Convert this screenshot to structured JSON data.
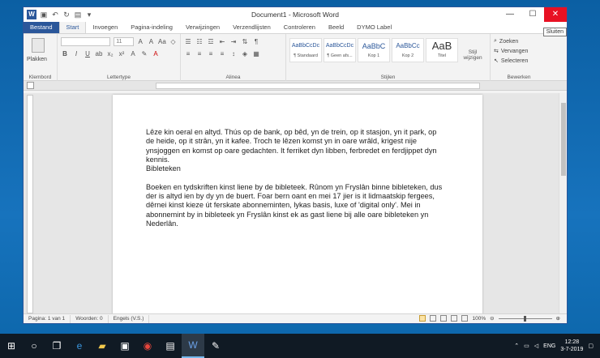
{
  "titlebar": {
    "title": "Document1 - Microsoft Word",
    "tooltip": "Sluiten",
    "controls": [
      "—",
      "☐",
      "✕"
    ]
  },
  "tabs": [
    "Bestand",
    "Start",
    "Invoegen",
    "Pagina-indeling",
    "Verwijzingen",
    "Verzendlijsten",
    "Controleren",
    "Beeld",
    "DYMO Label"
  ],
  "ribbon": {
    "clipboard": {
      "paste": "Plakken",
      "label": "Klembord"
    },
    "font": {
      "size": "11",
      "label": "Lettertype"
    },
    "paragraph": {
      "label": "Alinea"
    },
    "styles": {
      "label": "Stijlen",
      "items": [
        {
          "preview": "AaBbCcDc",
          "name": "¶ Standaard"
        },
        {
          "preview": "AaBbCcDc",
          "name": "¶ Geen afs..."
        },
        {
          "preview": "AaBbC",
          "name": "Kop 1"
        },
        {
          "preview": "AaBbCc",
          "name": "Kop 2"
        },
        {
          "preview": "AaB",
          "name": "Titel"
        }
      ],
      "change": "Stijl wijzigen"
    },
    "editing": {
      "label": "Bewerken",
      "find": "Zoeken",
      "replace": "Vervangen",
      "select": "Selecteren"
    }
  },
  "document": {
    "para1": "Lêze kin oeral en altyd. Thús op de bank, op bêd, yn de trein, op it stasjon, yn it park, op de heide, op it strân, yn it kafee. Troch te lêzen komst yn in oare wrâld, krigest nije ynsjoggen en komst op oare gedachten. It ferriket dyn libben, ferbredet en ferdjippet dyn kennis.",
    "heading": "Bibleteken",
    "para2": "Boeken en tydskriften kinst liene by de bibleteek. Rûnom yn Fryslân binne bibleteken, dus der is altyd ien by dy yn de buert. Foar bern oant en mei 17 jier is it lidmaatskip fergees, dêrnei kinst kieze út ferskate abonneminten, lykas basis, luxe of 'digital only'. Mei in abonnemint by in bibleteek yn Fryslân kinst ek as gast liene bij alle oare bibleteken yn Nederlân."
  },
  "statusbar": {
    "page": "Pagina: 1 van 1",
    "words": "Woorden: 0",
    "language": "Engels (V.S.)",
    "zoom": "100%"
  },
  "taskbar": {
    "language": "ENG",
    "time": "12:28",
    "date": "3-7-2019"
  }
}
